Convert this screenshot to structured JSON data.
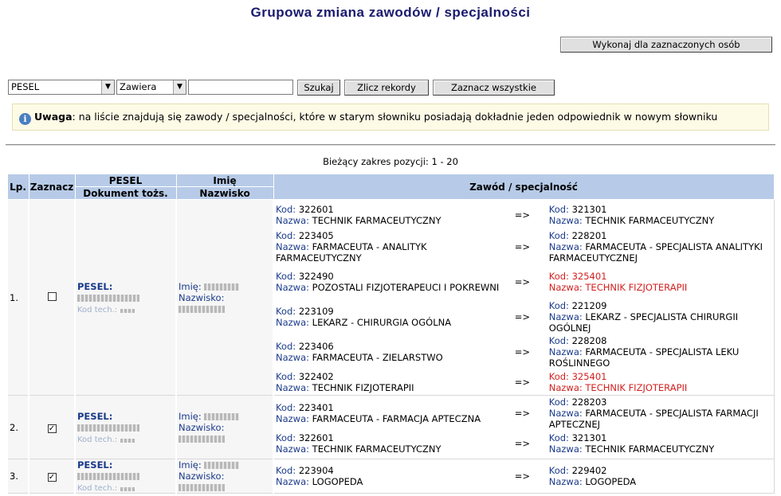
{
  "page": {
    "title": "Grupowa zmiana zawodów / specjalności"
  },
  "toolbar": {
    "execute_label": "Wykonaj dla zaznaczonych osób",
    "field_select_value": "PESEL",
    "condition_select_value": "Zawiera",
    "search_value": "",
    "search_label": "Szukaj",
    "count_label": "Zlicz rekordy",
    "select_all_label": "Zaznacz wszystkie"
  },
  "notice": {
    "bold": "Uwaga",
    "text": ": na liście znajdują się zawody / specjalności, które w starym słowniku posiadają dokładnie jeden odpowiednik w nowym słowniku"
  },
  "range": {
    "text": "Bieżący zakres pozycji: 1 - 20"
  },
  "table": {
    "headers": {
      "lp": "Lp.",
      "check": "Zaznacz",
      "pesel1": "PESEL",
      "pesel2": "Dokument tożs.",
      "name1": "Imię",
      "name2": "Nazwisko",
      "occupation": "Zawód / specjalność"
    },
    "labels": {
      "pesel": "PESEL:",
      "kod_tech": "Kod tech.:",
      "imie": "Imię:",
      "nazwisko": "Nazwisko:",
      "kod": "Kod:",
      "nazwa": "Nazwa:",
      "arrow": "=>"
    },
    "rows": [
      {
        "lp": "1.",
        "checked": false,
        "occupations": [
          {
            "old_code": "322601",
            "old_name": "TECHNIK FARMACEUTYCZNY",
            "new_code": "321301",
            "new_name": "TECHNIK FARMACEUTYCZNY",
            "warn": false
          },
          {
            "old_code": "223405",
            "old_name": "FARMACEUTA - ANALITYK FARMACEUTYCZNY",
            "new_code": "228201",
            "new_name": "FARMACEUTA - SPECJALISTA ANALITYKI FARMACEUTYCZNEJ",
            "warn": false
          },
          {
            "old_code": "322490",
            "old_name": "POZOSTALI FIZJOTERAPEUCI I POKREWNI",
            "new_code": "325401",
            "new_name": "TECHNIK FIZJOTERAPII",
            "warn": true
          },
          {
            "old_code": "223109",
            "old_name": "LEKARZ - CHIRURGIA OGÓLNA",
            "new_code": "221209",
            "new_name": "LEKARZ - SPECJALISTA CHIRURGII OGÓLNEJ",
            "warn": false
          },
          {
            "old_code": "223406",
            "old_name": "FARMACEUTA - ZIELARSTWO",
            "new_code": "228208",
            "new_name": "FARMACEUTA - SPECJALISTA LEKU ROŚLINNEGO",
            "warn": false
          },
          {
            "old_code": "322402",
            "old_name": "TECHNIK FIZJOTERAPII",
            "new_code": "325401",
            "new_name": "TECHNIK FIZJOTERAPII",
            "warn": true
          }
        ]
      },
      {
        "lp": "2.",
        "checked": true,
        "occupations": [
          {
            "old_code": "223401",
            "old_name": "FARMACEUTA - FARMACJA APTECZNA",
            "new_code": "228203",
            "new_name": "FARMACEUTA - SPECJALISTA FARMACJI APTECZNEJ",
            "warn": false
          },
          {
            "old_code": "322601",
            "old_name": "TECHNIK FARMACEUTYCZNY",
            "new_code": "321301",
            "new_name": "TECHNIK FARMACEUTYCZNY",
            "warn": false
          }
        ]
      },
      {
        "lp": "3.",
        "checked": true,
        "occupations": [
          {
            "old_code": "223904",
            "old_name": "LOGOPEDA",
            "new_code": "229402",
            "new_name": "LOGOPEDA",
            "warn": false
          }
        ]
      }
    ]
  }
}
